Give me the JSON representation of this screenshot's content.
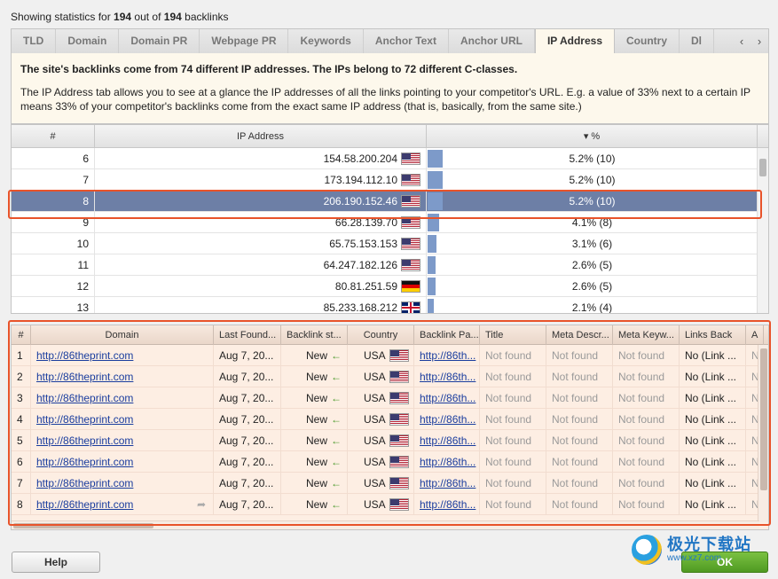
{
  "status": {
    "prefix": "Showing statistics for ",
    "shown": "194",
    "middle": " out of ",
    "total": "194",
    "suffix": " backlinks"
  },
  "tabs": [
    "TLD",
    "Domain",
    "Domain PR",
    "Webpage PR",
    "Keywords",
    "Anchor Text",
    "Anchor URL",
    "IP Address",
    "Country",
    "Dl"
  ],
  "active_tab": "IP Address",
  "tab_nav": {
    "prev": "‹",
    "next": "›"
  },
  "info": {
    "headline": "The site's backlinks come from 74 different IP addresses. The IPs belong to 72 different C-classes.",
    "body": "The IP Address tab allows you to see at a glance the IP addresses of all the links pointing to your competitor's URL. E.g. a value of 33% next to a certain IP means 33% of your competitor's backlinks come from the exact same IP address (that is, basically, from the same site.)"
  },
  "ip_table": {
    "columns": {
      "num": "#",
      "ip": "IP Address",
      "pct": "▾ %"
    },
    "rows": [
      {
        "num": "6",
        "ip": "154.58.200.204",
        "flag": "us",
        "pct": "5.2% (10)",
        "share": 5.2
      },
      {
        "num": "7",
        "ip": "173.194.112.10",
        "flag": "us",
        "pct": "5.2% (10)",
        "share": 5.2
      },
      {
        "num": "8",
        "ip": "206.190.152.46",
        "flag": "us",
        "pct": "5.2% (10)",
        "share": 5.2,
        "selected": true
      },
      {
        "num": "9",
        "ip": "66.28.139.70",
        "flag": "us",
        "pct": "4.1% (8)",
        "share": 4.1
      },
      {
        "num": "10",
        "ip": "65.75.153.153",
        "flag": "us",
        "pct": "3.1% (6)",
        "share": 3.1
      },
      {
        "num": "11",
        "ip": "64.247.182.126",
        "flag": "us",
        "pct": "2.6% (5)",
        "share": 2.6
      },
      {
        "num": "12",
        "ip": "80.81.251.59",
        "flag": "de",
        "pct": "2.6% (5)",
        "share": 2.6
      },
      {
        "num": "13",
        "ip": "85.233.168.212",
        "flag": "gb",
        "pct": "2.1% (4)",
        "share": 2.1
      }
    ]
  },
  "backlinks_table": {
    "columns": [
      "#",
      "Domain",
      "Last Found...",
      "Backlink st...",
      "Country",
      "Backlink Pa...",
      "Title",
      "Meta Descr...",
      "Meta Keyw...",
      "Links Back",
      "A"
    ],
    "rows": [
      {
        "num": "1",
        "domain": "http://86theprint.com",
        "last_found": "Aug 7, 20...",
        "status": "New",
        "country": "USA",
        "page": "http://86th...",
        "title": "Not found",
        "meta_desc": "Not found",
        "meta_kw": "Not found",
        "links_back": "No (Link ...",
        "a": "N"
      },
      {
        "num": "2",
        "domain": "http://86theprint.com",
        "last_found": "Aug 7, 20...",
        "status": "New",
        "country": "USA",
        "page": "http://86th...",
        "title": "Not found",
        "meta_desc": "Not found",
        "meta_kw": "Not found",
        "links_back": "No (Link ...",
        "a": "N"
      },
      {
        "num": "3",
        "domain": "http://86theprint.com",
        "last_found": "Aug 7, 20...",
        "status": "New",
        "country": "USA",
        "page": "http://86th...",
        "title": "Not found",
        "meta_desc": "Not found",
        "meta_kw": "Not found",
        "links_back": "No (Link ...",
        "a": "N"
      },
      {
        "num": "4",
        "domain": "http://86theprint.com",
        "last_found": "Aug 7, 20...",
        "status": "New",
        "country": "USA",
        "page": "http://86th...",
        "title": "Not found",
        "meta_desc": "Not found",
        "meta_kw": "Not found",
        "links_back": "No (Link ...",
        "a": "N"
      },
      {
        "num": "5",
        "domain": "http://86theprint.com",
        "last_found": "Aug 7, 20...",
        "status": "New",
        "country": "USA",
        "page": "http://86th...",
        "title": "Not found",
        "meta_desc": "Not found",
        "meta_kw": "Not found",
        "links_back": "No (Link ...",
        "a": "N"
      },
      {
        "num": "6",
        "domain": "http://86theprint.com",
        "last_found": "Aug 7, 20...",
        "status": "New",
        "country": "USA",
        "page": "http://86th...",
        "title": "Not found",
        "meta_desc": "Not found",
        "meta_kw": "Not found",
        "links_back": "No (Link ...",
        "a": "N"
      },
      {
        "num": "7",
        "domain": "http://86theprint.com",
        "last_found": "Aug 7, 20...",
        "status": "New",
        "country": "USA",
        "page": "http://86th...",
        "title": "Not found",
        "meta_desc": "Not found",
        "meta_kw": "Not found",
        "links_back": "No (Link ...",
        "a": "N"
      },
      {
        "num": "8",
        "domain": "http://86theprint.com",
        "last_found": "Aug 7, 20...",
        "status": "New",
        "country": "USA",
        "page": "http://86th...",
        "title": "Not found",
        "meta_desc": "Not found",
        "meta_kw": "Not found",
        "links_back": "No (Link ...",
        "a": "N",
        "share_icon": true
      }
    ]
  },
  "buttons": {
    "help": "Help",
    "ok": "OK"
  },
  "watermark": {
    "text": "极光下载站",
    "url": "www.xz7.com"
  },
  "colors": {
    "selected_row": "#6d7fa6",
    "bar": "#7d9ac9",
    "highlight": "#e8532a",
    "link": "#1a3d9e",
    "new_arrow": "#4a9a2a"
  }
}
